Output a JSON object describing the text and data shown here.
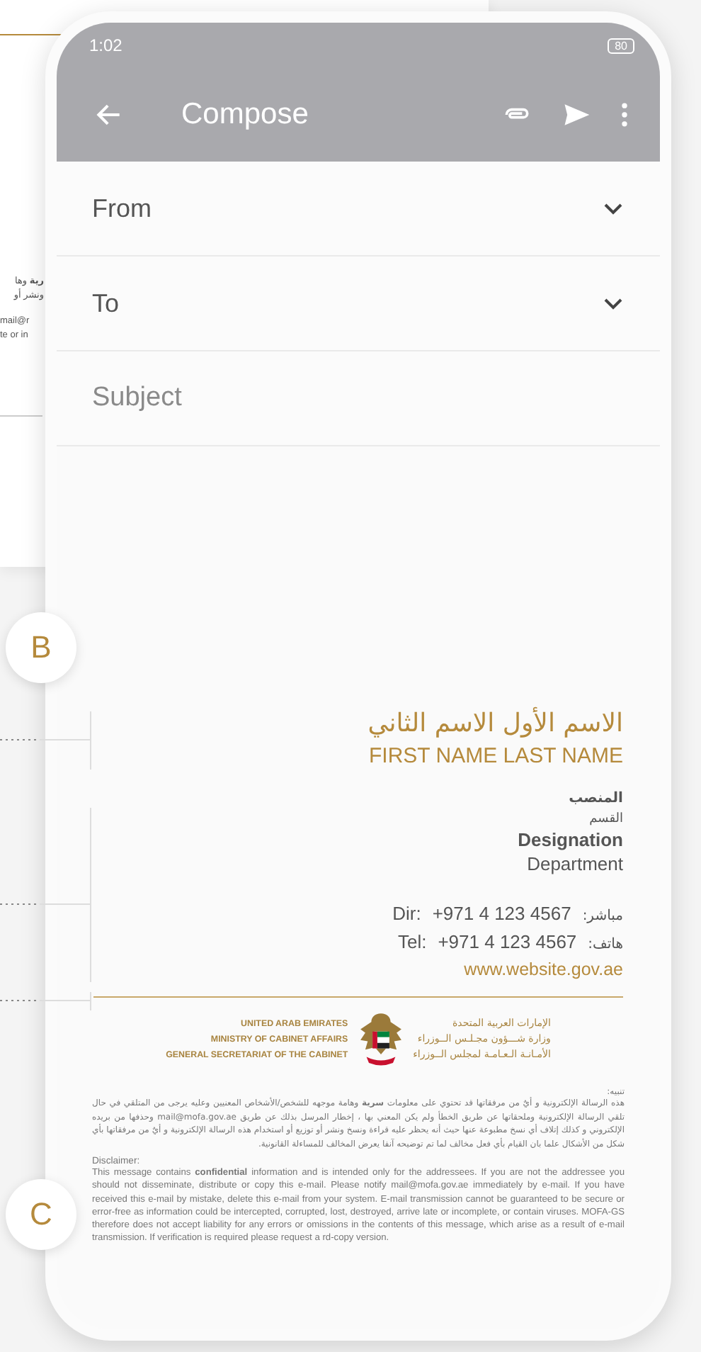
{
  "background_card": {
    "texts": [
      {
        "text": "**رية** وها"
      },
      {
        "text": "ونشر أو"
      },
      {
        "text": "mail@r"
      },
      {
        "text": "te or in"
      }
    ]
  },
  "callouts": [
    {
      "label": "B"
    },
    {
      "label": "C"
    }
  ],
  "phone": {
    "status_bar": {
      "time": "1:02",
      "battery": "80"
    },
    "app_bar": {
      "title": "Compose"
    },
    "fields": [
      {
        "kind": "dropdown",
        "label": "From"
      },
      {
        "kind": "dropdown",
        "label": "To"
      },
      {
        "kind": "text",
        "placeholder": "Subject"
      }
    ]
  },
  "signature": {
    "name_ar": "الاسم الأول الاسم الثاني",
    "name_en": "FIRST NAME LAST NAME",
    "designation_ar": "المنصب",
    "department_ar": "القسم",
    "designation": "Designation",
    "department": "Department",
    "contacts": [
      {
        "label": "Dir:",
        "number": "+971 4 123 4567",
        "label_ar": "مباشر:"
      },
      {
        "label": "Tel:",
        "number": "+971 4 123 4567",
        "label_ar": "هاتف:"
      }
    ],
    "website": "www.website.gov.ae",
    "logo": {
      "lines_en": [
        "UNITED ARAB EMIRATES",
        "MINISTRY OF CABINET AFFAIRS",
        "GENERAL SECRETARIAT OF THE CABINET"
      ],
      "lines_ar": [
        "الإمارات العربية المتحدة",
        "وزارة شـــؤون مجـلـس الــوزراء",
        "الأمـانـة الـعـامـة لمجلس الــوزراء"
      ]
    },
    "disclaimer": {
      "heading_ar": "تنبيه:",
      "body_ar": "هذه الرسالة الإلكترونية و أيٌ من مرفقاتها قد تحتوي على معلومات **سرية** وهامة موجهه للشخص/الأشخاص المعنيين وعليه يرجى من المتلقي في حال تلقي الرسالة الإلكترونية وملحقاتها عن طريق الخطأ ولم يكن المعني بها ، إخطار المرسل بذلك عن طريق mail@mofa.gov.ae وحذفها من بريده الإلكتروني و كذلك إتلاف أي نسخ مطبوعة عنها حيث أنه يحظر عليه قراءة ونسخ ونشر أو توزيع أو استخدام هذه الرسالة الإلكترونية و أيٌ من مرفقاتها بأي شكل من الأشكال علما بان القيام بأي فعل مخالف لما تم توضيحه آنفا يعرض المخالف للمساءلة القانونية.",
      "heading_en": "Disclaimer:",
      "body_en": "This message contains **confidential** information and is intended only for the addressees. If you are not the addressee you should not disseminate, distribute or copy this e-mail. Please notify mail@mofa.gov.ae immediately by e-mail. If you have received this e-mail by mistake, delete this e-mail from your system. E-mail transmission cannot be guaranteed to be secure or error-free as information could be intercepted, corrupted, lost, destroyed, arrive late or incomplete, or contain viruses. MOFA-GS therefore does not accept liability for any errors or omissions in the contents of this message, which arise as a result of e-mail transmission. If verification is required please request a rd-copy version."
    }
  }
}
